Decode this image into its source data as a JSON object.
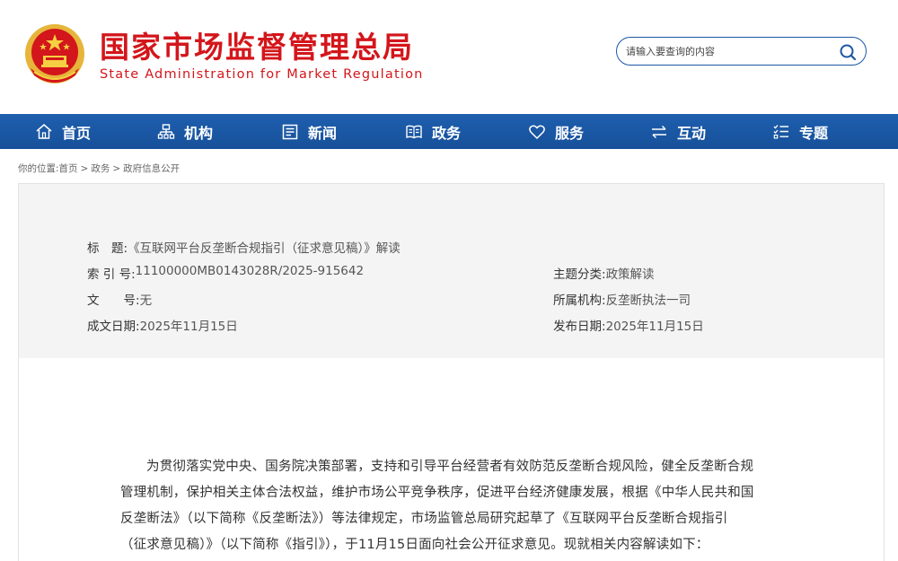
{
  "header": {
    "title_cn": "国家市场监督管理总局",
    "title_en": "State Administration for Market Regulation",
    "search_placeholder": "请输入要查询的内容"
  },
  "nav": {
    "items": [
      {
        "label": "首页",
        "icon": "home-icon"
      },
      {
        "label": "机构",
        "icon": "org-chart-icon"
      },
      {
        "label": "新闻",
        "icon": "news-icon"
      },
      {
        "label": "政务",
        "icon": "book-icon"
      },
      {
        "label": "服务",
        "icon": "heart-icon"
      },
      {
        "label": "互动",
        "icon": "exchange-icon"
      },
      {
        "label": "专题",
        "icon": "list-icon"
      }
    ]
  },
  "breadcrumb": {
    "prefix": "你的位置:",
    "items": [
      "首页",
      "政务",
      "政府信息公开"
    ],
    "separator": ">"
  },
  "info": {
    "title_key": "标　题:",
    "title_val": "《互联网平台反垄断合规指引（征求意见稿）》解读",
    "index_key": "索 引 号:",
    "index_val": "11100000MB0143028R/2025-915642",
    "docno_key": "文　　号:",
    "docno_val": "无",
    "date_key": "成文日期:",
    "date_val": "2025年11月15日",
    "category_key": "主题分类:",
    "category_val": "政策解读",
    "agency_key": "所属机构:",
    "agency_val": "反垄断执法一司",
    "publish_key": "发布日期:",
    "publish_val": "2025年11月15日"
  },
  "article": {
    "lines": [
      "为贯彻落实党中央、国务院决策部署，支持和引导平台经营者有效防范反垄断合规风险，健全反垄断合规",
      "管理机制，保护相关主体合法权益，维护市场公平竞争秩序，促进平台经济健康发展，根据《中华人民共和国",
      "反垄断法》（以下简称《反垄断法》）等法律规定，市场监管总局研究起草了《互联网平台反垄断合规指引",
      "（征求意见稿）》（以下简称《指引》），于11月15日面向社会公开征求意见。现就相关内容解读如下："
    ]
  },
  "colors": {
    "brand_red": "#d3161b",
    "nav_blue": "#1e5fae",
    "panel_gray": "#f4f4f4"
  }
}
